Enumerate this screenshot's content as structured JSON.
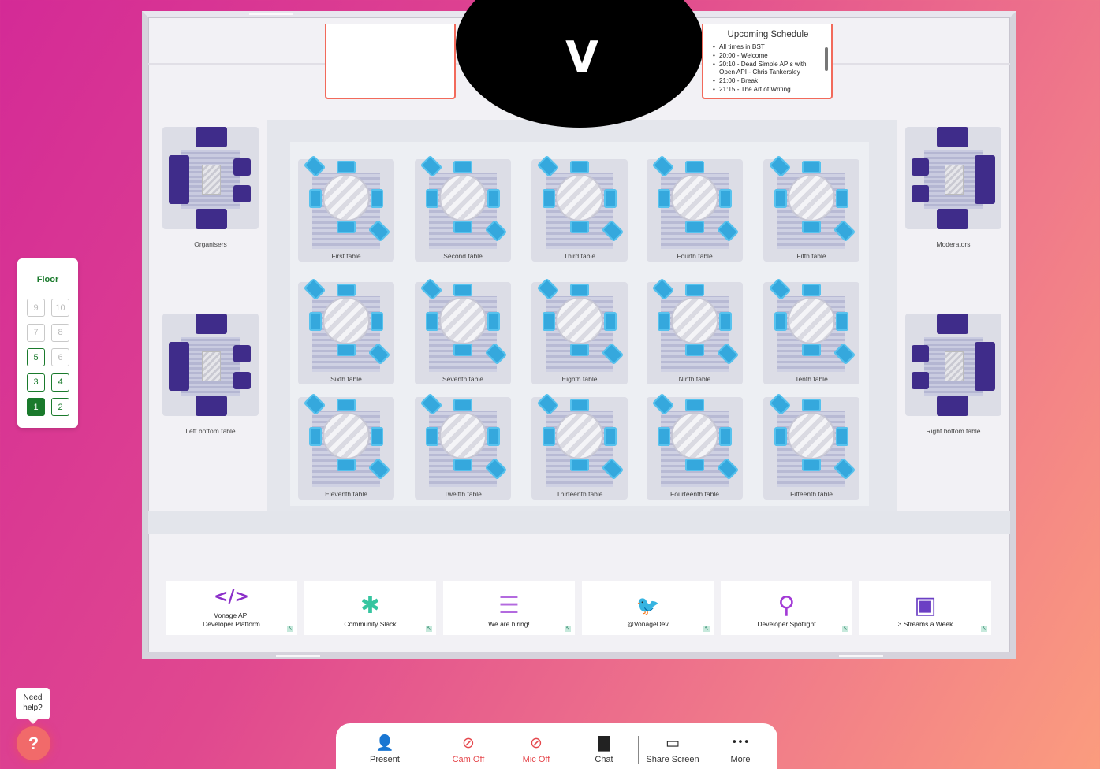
{
  "floor": {
    "title": "Floor",
    "buttons": [
      {
        "label": "9",
        "state": "disabled"
      },
      {
        "label": "10",
        "state": "disabled"
      },
      {
        "label": "7",
        "state": "disabled"
      },
      {
        "label": "8",
        "state": "disabled"
      },
      {
        "label": "5",
        "state": "enabled"
      },
      {
        "label": "6",
        "state": "disabled"
      },
      {
        "label": "3",
        "state": "enabled"
      },
      {
        "label": "4",
        "state": "enabled"
      },
      {
        "label": "1",
        "state": "active"
      },
      {
        "label": "2",
        "state": "enabled"
      }
    ]
  },
  "stage": {
    "logo": "V"
  },
  "schedule": {
    "title": "Upcoming Schedule",
    "items": [
      "All times in BST",
      "20:00 - Welcome",
      "20:10 - Dead Simple APIs with Open API - Chris Tankersley",
      "21:00 - Break",
      "21:15 - The Art of Writing"
    ]
  },
  "lounges": {
    "organisers": "Organisers",
    "moderators": "Moderators",
    "left_bottom": "Left bottom table",
    "right_bottom": "Right bottom table"
  },
  "tables": [
    "First table",
    "Second table",
    "Third table",
    "Fourth table",
    "Fifth table",
    "Sixth table",
    "Seventh table",
    "Eighth table",
    "Ninth table",
    "Tenth table",
    "Eleventh table",
    "Twelfth table",
    "Thirteenth table",
    "Fourteenth table",
    "Fifteenth table"
  ],
  "tiles": [
    {
      "label": "Vonage API\nDeveloper Platform",
      "icon": "code-icon",
      "glyph": "</>",
      "color": "#8b2fc9"
    },
    {
      "label": "Community Slack",
      "icon": "slack-icon",
      "glyph": "✱",
      "color": "#36c5a0"
    },
    {
      "label": "We are hiring!",
      "icon": "hiring-icon",
      "glyph": "☰",
      "color": "#b36adf"
    },
    {
      "label": "@VonageDev",
      "icon": "twitter-icon",
      "glyph": "🐦",
      "color": "#1da1f2"
    },
    {
      "label": "Developer Spotlight",
      "icon": "magnifier-icon",
      "glyph": "⚲",
      "color": "#a23ad6"
    },
    {
      "label": "3 Streams a Week",
      "icon": "twitch-icon",
      "glyph": "▣",
      "color": "#6b3fc4"
    }
  ],
  "help": {
    "text": "Need help?",
    "glyph": "?"
  },
  "toolbar": {
    "present": {
      "label": "Present",
      "icon": "present-icon",
      "glyph": "👤"
    },
    "cam": {
      "label": "Cam Off",
      "icon": "camera-off-icon",
      "glyph": "⊘"
    },
    "mic": {
      "label": "Mic Off",
      "icon": "mic-off-icon",
      "glyph": "⊘"
    },
    "chat": {
      "label": "Chat",
      "icon": "chat-icon",
      "glyph": "▇"
    },
    "share": {
      "label": "Share Screen",
      "icon": "share-screen-icon",
      "glyph": "▭"
    },
    "more": {
      "label": "More",
      "icon": "more-icon",
      "glyph": "•••"
    }
  },
  "colors": {
    "accent_green": "#1a7a2c",
    "alert_red": "#e5484d",
    "chair_blue": "#35a8dd",
    "sofa_purple": "#3f2c8a"
  }
}
